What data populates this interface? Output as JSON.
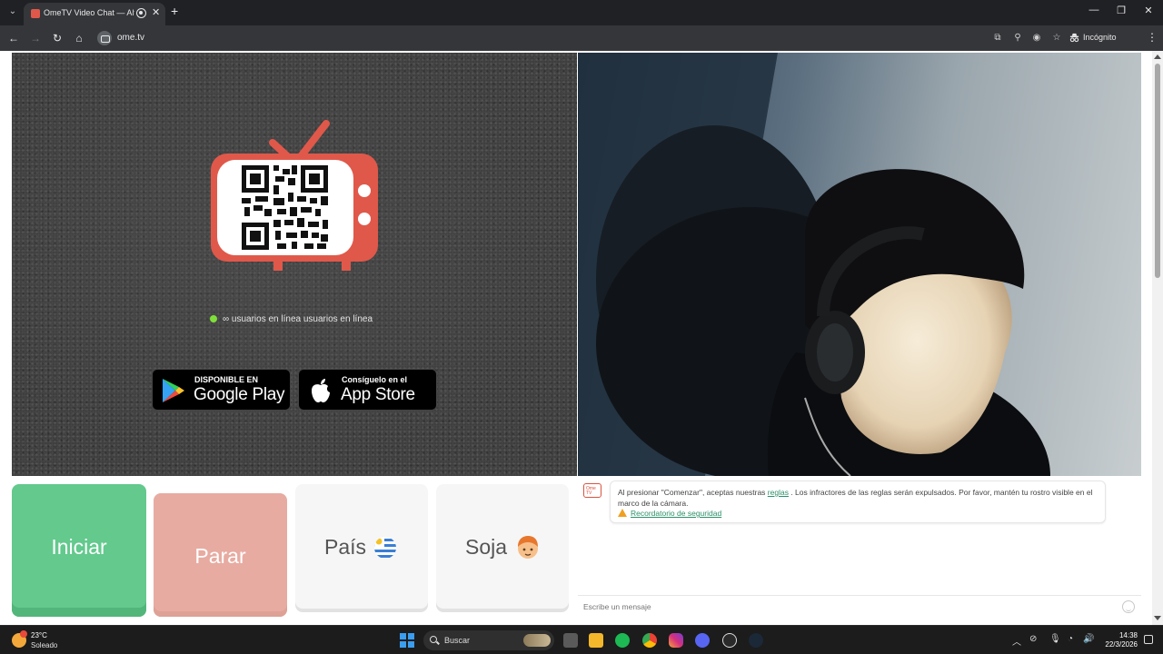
{
  "browser": {
    "tab_title": "OmeTV Video Chat — Alte",
    "url": "ome.tv",
    "incognito_label": "Incógnito",
    "new_tab_label": "+",
    "close_tab_label": "✕"
  },
  "left_panel": {
    "online_text": "∞ usuarios en línea usuarios en línea",
    "google_play": {
      "small": "DISPONIBLE EN",
      "big": "Google Play"
    },
    "app_store": {
      "small": "Consíguelo en el",
      "big": "App Store"
    }
  },
  "controls": {
    "start_label": "Iniciar",
    "stop_label": "Parar",
    "country_label": "País",
    "gender_label": "Soja"
  },
  "chat": {
    "logo_text": "Ome TV",
    "message_pre": "Al presionar \"Comenzar\", aceptas nuestras",
    "rules_link": "reglas",
    "message_post": ". Los infractores de las reglas serán expulsados. Por favor, mantén tu rostro visible en el marco de la cámara.",
    "safety_link": "Recordatorio de seguridad",
    "input_placeholder": "Escribe un mensaje"
  },
  "taskbar": {
    "temperature": "23°C",
    "condition": "Soleado",
    "search_placeholder": "Buscar",
    "time": "14:38",
    "date": "22/3/2026"
  },
  "colors": {
    "start_green": "#63c98d",
    "stop_pink": "#e7aba1",
    "tv_red": "#e0584a",
    "online_dot": "#7ee038"
  }
}
